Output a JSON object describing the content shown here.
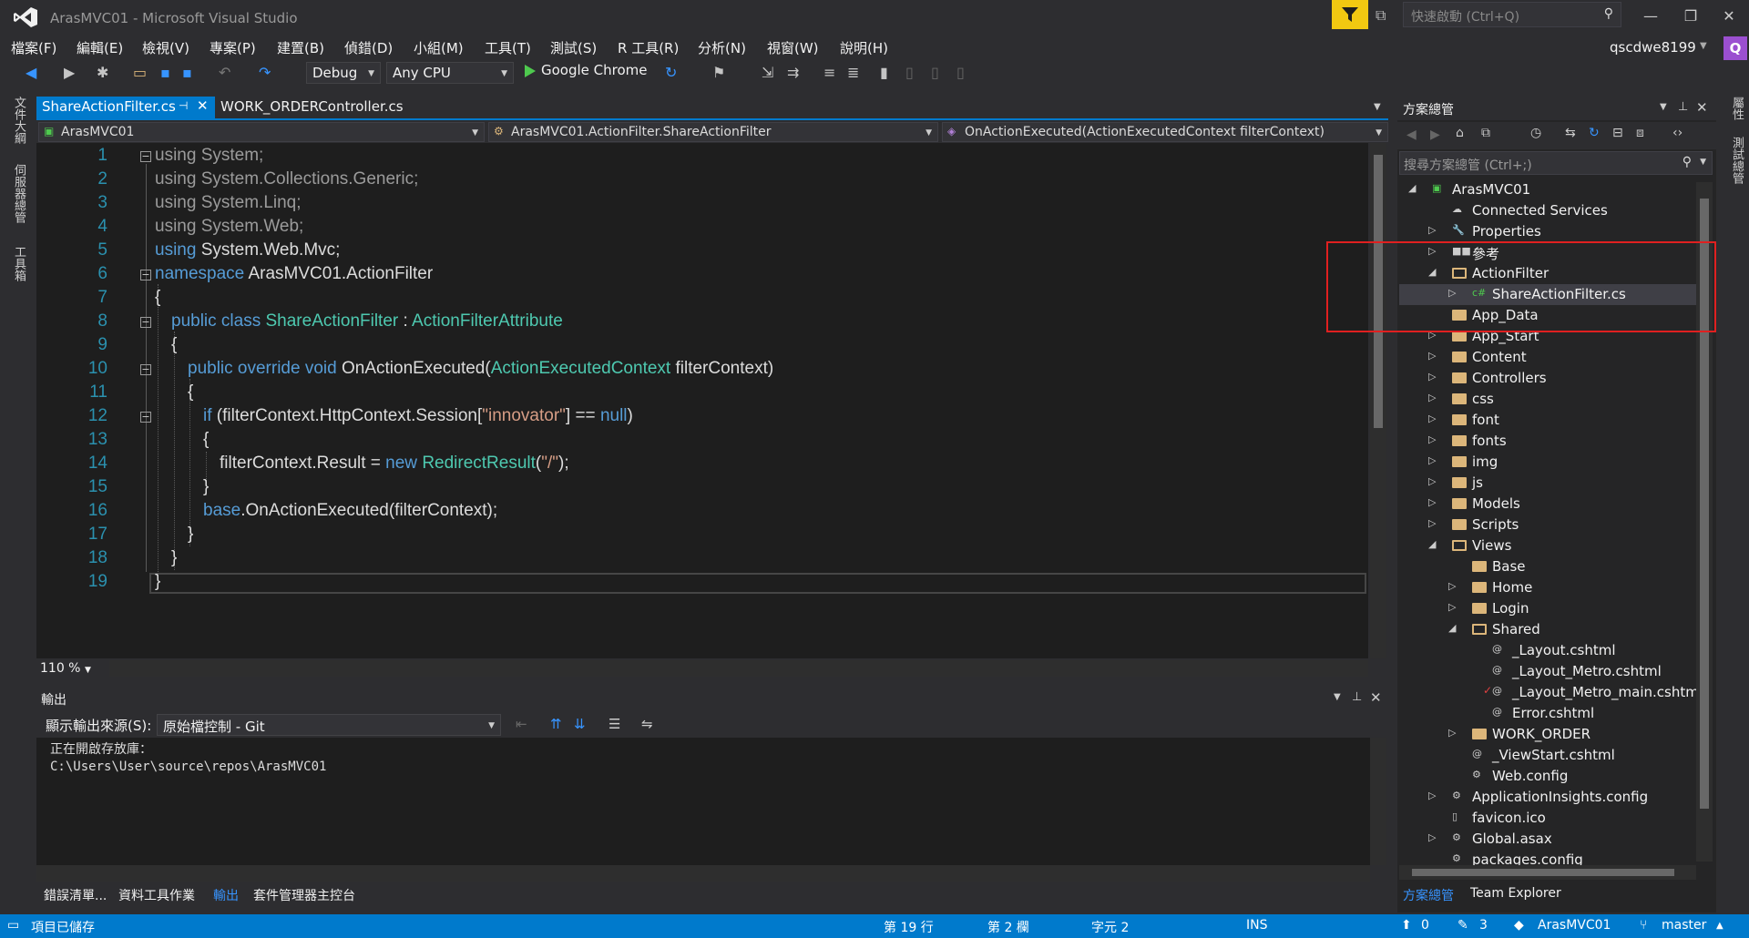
{
  "window": {
    "title": "ArasMVC01 - Microsoft Visual Studio",
    "quick_launch_placeholder": "快速啟動 (Ctrl+Q)",
    "user": "qscdwe8199",
    "user_initial": "Q"
  },
  "menu": [
    "檔案(F)",
    "編輯(E)",
    "檢視(V)",
    "專案(P)",
    "建置(B)",
    "偵錯(D)",
    "小組(M)",
    "工具(T)",
    "測試(S)",
    "R 工具(R)",
    "分析(N)",
    "視窗(W)",
    "說明(H)"
  ],
  "toolbar": {
    "config": "Debug",
    "platform": "Any CPU",
    "run_target": "Google Chrome"
  },
  "left_tabs": [
    "文件大綱",
    "伺服器總管",
    "工具箱"
  ],
  "right_tabs": [
    "屬性",
    "測試總管"
  ],
  "editor": {
    "tabs": [
      {
        "label": "ShareActionFilter.cs",
        "active": true
      },
      {
        "label": "WORK_ORDERController.cs",
        "active": false
      }
    ],
    "nav_project": "ArasMVC01",
    "nav_class": "ArasMVC01.ActionFilter.ShareActionFilter",
    "nav_member": "OnActionExecuted(ActionExecutedContext filterContext)",
    "zoom": "110 %",
    "line_numbers": [
      "1",
      "2",
      "3",
      "4",
      "5",
      "6",
      "7",
      "8",
      "9",
      "10",
      "11",
      "12",
      "13",
      "14",
      "15",
      "16",
      "17",
      "18",
      "19"
    ],
    "code": {
      "l1a": "using",
      "l1b": " System;",
      "l2a": "using",
      "l2b": " System.Collections.Generic;",
      "l3a": "using",
      "l3b": " System.Linq;",
      "l4a": "using",
      "l4b": " System.Web;",
      "l5a": "using",
      "l5b": " System.Web.Mvc;",
      "l6a": "namespace",
      "l6b": " ArasMVC01.ActionFilter",
      "l7": "{",
      "l8a": "public class ",
      "l8b": "ShareActionFilter",
      "l8c": " : ",
      "l8d": "ActionFilterAttribute",
      "l9": "{",
      "l10a": "public override void ",
      "l10b": "OnActionExecuted(",
      "l10c": "ActionExecutedContext",
      "l10d": " filterContext)",
      "l11": "{",
      "l12a": "if ",
      "l12b": "(filterContext.HttpContext.Session[",
      "l12c": "\"innovator\"",
      "l12d": "] == ",
      "l12e": "null",
      "l12f": ")",
      "l13": "{",
      "l14a": "filterContext.Result = ",
      "l14b": "new ",
      "l14c": "RedirectResult",
      "l14d": "(",
      "l14e": "\"/\"",
      "l14f": ");",
      "l15": "}",
      "l16a": "base",
      "l16b": ".OnActionExecuted(filterContext);",
      "l17": "}",
      "l18": "}",
      "l19": "}"
    }
  },
  "output": {
    "title": "輸出",
    "source_label": "顯示輸出來源(S):",
    "source_value": "原始檔控制 - Git",
    "lines": [
      "正在開啟存放庫：",
      "C:\\Users\\User\\source\\repos\\ArasMVC01"
    ]
  },
  "bottom_tabs": [
    "錯誤清單...",
    "資料工具作業",
    "輸出",
    "套件管理器主控台"
  ],
  "solution_explorer": {
    "title": "方案總管",
    "search_placeholder": "搜尋方案總管 (Ctrl+;)",
    "items": [
      {
        "label": "ArasMVC01",
        "indent": 0,
        "arrow": "open",
        "kind": "project"
      },
      {
        "label": "Connected Services",
        "indent": 1,
        "arrow": "none",
        "kind": "service"
      },
      {
        "label": "Properties",
        "indent": 1,
        "arrow": "closed",
        "kind": "wrench"
      },
      {
        "label": "參考",
        "indent": 1,
        "arrow": "closed",
        "kind": "ref"
      },
      {
        "label": "ActionFilter",
        "indent": 1,
        "arrow": "open",
        "kind": "folder-open"
      },
      {
        "label": "ShareActionFilter.cs",
        "indent": 2,
        "arrow": "closed",
        "kind": "cs"
      },
      {
        "label": "App_Data",
        "indent": 1,
        "arrow": "none",
        "kind": "folder"
      },
      {
        "label": "App_Start",
        "indent": 1,
        "arrow": "closed",
        "kind": "folder"
      },
      {
        "label": "Content",
        "indent": 1,
        "arrow": "closed",
        "kind": "folder"
      },
      {
        "label": "Controllers",
        "indent": 1,
        "arrow": "closed",
        "kind": "folder"
      },
      {
        "label": "css",
        "indent": 1,
        "arrow": "closed",
        "kind": "folder"
      },
      {
        "label": "font",
        "indent": 1,
        "arrow": "closed",
        "kind": "folder"
      },
      {
        "label": "fonts",
        "indent": 1,
        "arrow": "closed",
        "kind": "folder"
      },
      {
        "label": "img",
        "indent": 1,
        "arrow": "closed",
        "kind": "folder"
      },
      {
        "label": "js",
        "indent": 1,
        "arrow": "closed",
        "kind": "folder"
      },
      {
        "label": "Models",
        "indent": 1,
        "arrow": "closed",
        "kind": "folder"
      },
      {
        "label": "Scripts",
        "indent": 1,
        "arrow": "closed",
        "kind": "folder"
      },
      {
        "label": "Views",
        "indent": 1,
        "arrow": "open",
        "kind": "folder-open"
      },
      {
        "label": "Base",
        "indent": 2,
        "arrow": "none",
        "kind": "folder"
      },
      {
        "label": "Home",
        "indent": 2,
        "arrow": "closed",
        "kind": "folder"
      },
      {
        "label": "Login",
        "indent": 2,
        "arrow": "closed",
        "kind": "folder"
      },
      {
        "label": "Shared",
        "indent": 2,
        "arrow": "open",
        "kind": "folder-open"
      },
      {
        "label": "_Layout.cshtml",
        "indent": 3,
        "arrow": "none",
        "kind": "cshtml"
      },
      {
        "label": "_Layout_Metro.cshtml",
        "indent": 3,
        "arrow": "none",
        "kind": "cshtml"
      },
      {
        "label": "_Layout_Metro_main.cshtml",
        "indent": 3,
        "arrow": "none",
        "kind": "cshtml-modified"
      },
      {
        "label": "Error.cshtml",
        "indent": 3,
        "arrow": "none",
        "kind": "cshtml"
      },
      {
        "label": "WORK_ORDER",
        "indent": 2,
        "arrow": "closed",
        "kind": "folder"
      },
      {
        "label": "_ViewStart.cshtml",
        "indent": 2,
        "arrow": "none",
        "kind": "cshtml"
      },
      {
        "label": "Web.config",
        "indent": 2,
        "arrow": "none",
        "kind": "config"
      },
      {
        "label": "ApplicationInsights.config",
        "indent": 1,
        "arrow": "closed",
        "kind": "config"
      },
      {
        "label": "favicon.ico",
        "indent": 1,
        "arrow": "none",
        "kind": "file"
      },
      {
        "label": "Global.asax",
        "indent": 1,
        "arrow": "closed",
        "kind": "config"
      },
      {
        "label": "packages.config",
        "indent": 1,
        "arrow": "none",
        "kind": "config"
      }
    ],
    "selected_index": 5,
    "bottom_tabs": [
      "方案總管",
      "Team Explorer"
    ]
  },
  "status": {
    "left": "項目已儲存",
    "line": "第 19 行",
    "col": "第 2 欄",
    "char": "字元 2",
    "mode": "INS",
    "up_count": "0",
    "edit_count": "3",
    "repo": "ArasMVC01",
    "branch": "master"
  },
  "colors": {
    "accent": "#007acc",
    "keyword": "#569cd6",
    "type": "#4ec9b0",
    "string": "#d69d85",
    "folder": "#dcb67a",
    "highlight_box": "#e02020"
  }
}
